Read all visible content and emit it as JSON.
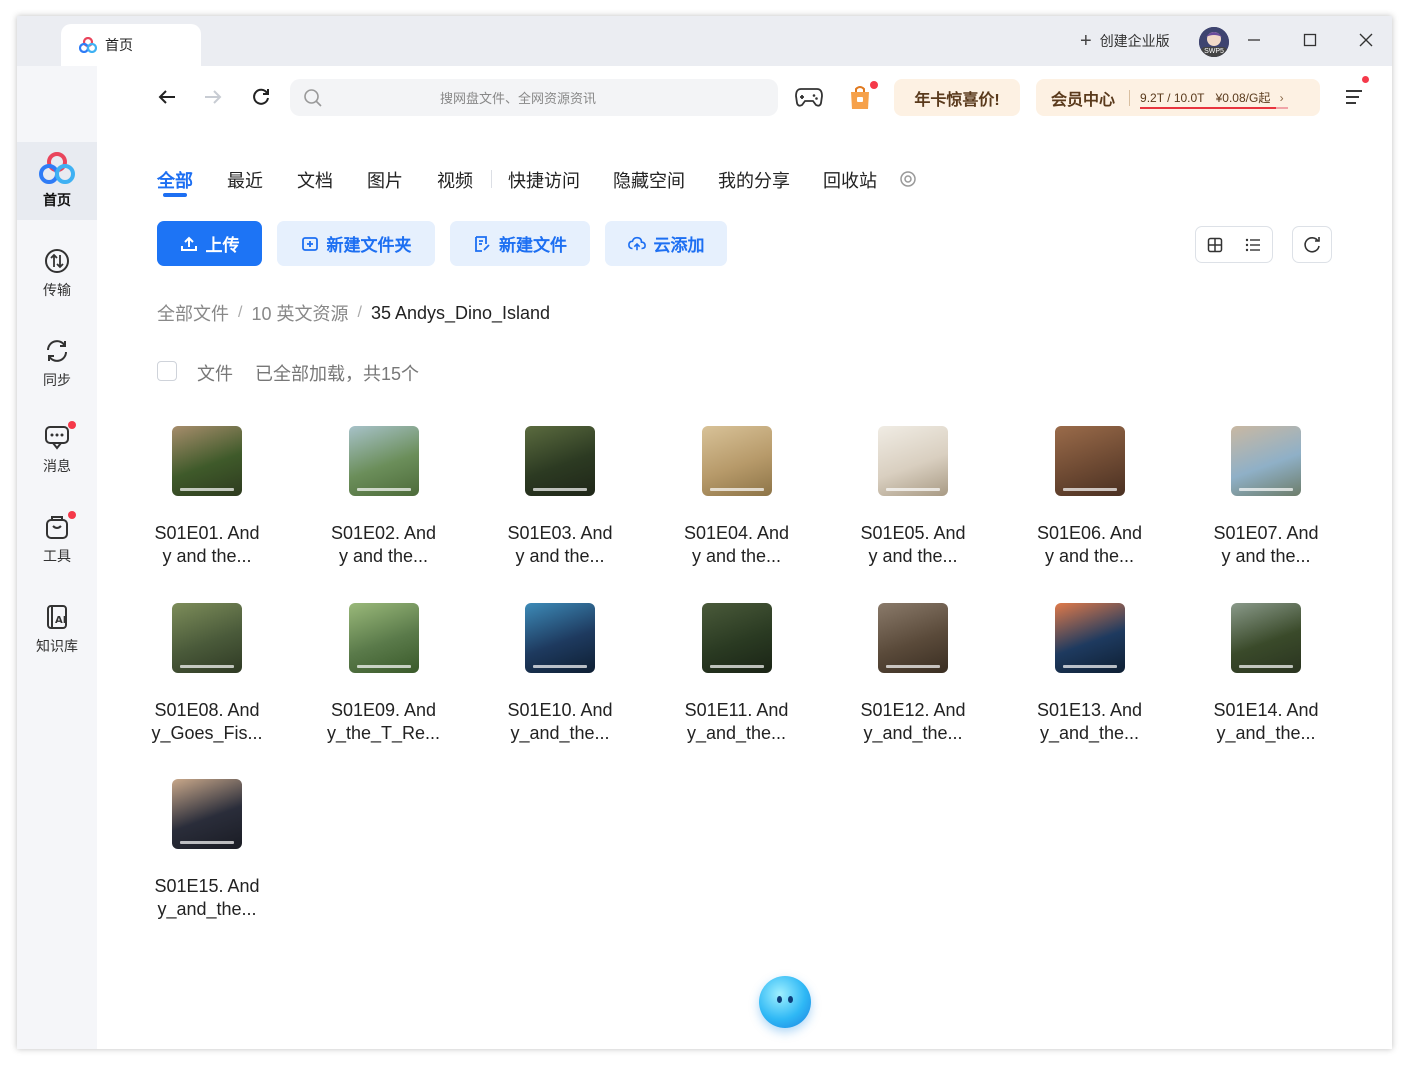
{
  "window": {
    "tab_title": "首页",
    "create_enterprise": "创建企业版",
    "avatar_badge": "SWP5"
  },
  "sidebar": {
    "items": [
      {
        "label": "首页",
        "icon": "cloud-logo-icon"
      },
      {
        "label": "传输",
        "icon": "transfer-icon"
      },
      {
        "label": "同步",
        "icon": "sync-icon"
      },
      {
        "label": "消息",
        "icon": "message-icon"
      },
      {
        "label": "工具",
        "icon": "toolbox-icon"
      },
      {
        "label": "知识库",
        "icon": "ai-knowledge-icon"
      }
    ]
  },
  "toolbar": {
    "search_placeholder": "搜网盘文件、全网资源资讯",
    "promo": "年卡惊喜价!",
    "vip_title": "会员中心",
    "quota": "9.2T / 10.0T",
    "price": "¥0.08/G起",
    "quota_used_fraction": 0.92
  },
  "categories": [
    "全部",
    "最近",
    "文档",
    "图片",
    "视频",
    "快捷访问",
    "隐藏空间",
    "我的分享",
    "回收站"
  ],
  "actions": {
    "upload": "上传",
    "new_folder": "新建文件夹",
    "new_file": "新建文件",
    "cloud_add": "云添加"
  },
  "breadcrumb": [
    "全部文件",
    "10 英文资源",
    "35 Andys_Dino_Island"
  ],
  "list_header": {
    "file_label": "文件",
    "loaded_text": "已全部加载，共15个"
  },
  "files": [
    {
      "line1": "S01E01. And",
      "line2": "y and the..."
    },
    {
      "line1": "S01E02. And",
      "line2": "y and the..."
    },
    {
      "line1": "S01E03. And",
      "line2": "y and the..."
    },
    {
      "line1": "S01E04. And",
      "line2": "y and the..."
    },
    {
      "line1": "S01E05. And",
      "line2": "y and the..."
    },
    {
      "line1": "S01E06. And",
      "line2": "y and the..."
    },
    {
      "line1": "S01E07. And",
      "line2": "y and the..."
    },
    {
      "line1": "S01E08. And",
      "line2": "y_Goes_Fis..."
    },
    {
      "line1": "S01E09. And",
      "line2": "y_the_T_Re..."
    },
    {
      "line1": "S01E10. And",
      "line2": "y_and_the..."
    },
    {
      "line1": "S01E11. And",
      "line2": "y_and_the..."
    },
    {
      "line1": "S01E12. And",
      "line2": "y_and_the..."
    },
    {
      "line1": "S01E13. And",
      "line2": "y_and_the..."
    },
    {
      "line1": "S01E14. And",
      "line2": "y_and_the..."
    },
    {
      "line1": "S01E15. And",
      "line2": "y_and_the..."
    }
  ],
  "colors": {
    "accent": "#1d6ff2",
    "primary_button": "#1d74f5",
    "promo_bg": "#fdf1e3",
    "badge_red": "#f5394a"
  }
}
